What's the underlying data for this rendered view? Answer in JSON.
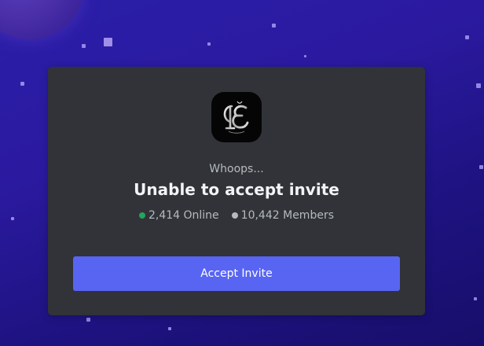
{
  "background": {
    "color_top": "#2a1ea8",
    "color_bottom": "#170e6a"
  },
  "invite": {
    "server_icon": "server-monogram-icon",
    "subtitle": "Whoops...",
    "title": "Unable to accept invite",
    "online": {
      "count": "2,414 Online",
      "dot_color": "#23a55a"
    },
    "members": {
      "count": "10,442 Members",
      "dot_color": "#b5bac1"
    },
    "accept_button_label": "Accept Invite",
    "accent_color": "#5865f2"
  }
}
